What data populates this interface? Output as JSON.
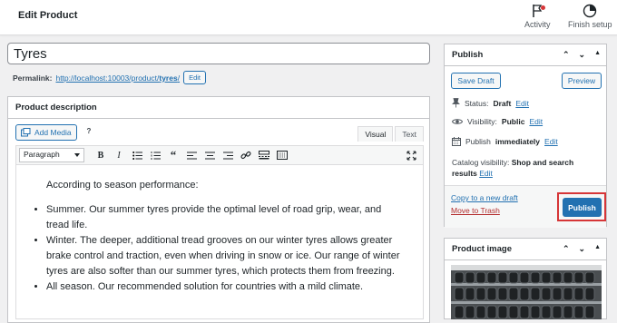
{
  "header": {
    "title": "Edit Product",
    "activity_label": "Activity",
    "finish_setup_label": "Finish setup"
  },
  "product": {
    "title_value": "Tyres",
    "permalink_label": "Permalink:",
    "permalink_base": "http://localhost:10003/product/",
    "permalink_slug": "tyres",
    "permalink_end": "/",
    "edit_label": "Edit"
  },
  "editor": {
    "panel_title": "Product description",
    "add_media_label": "Add Media",
    "help_label": "?",
    "tab_visual": "Visual",
    "tab_text": "Text",
    "format_value": "Paragraph",
    "intro": "According to season performance:",
    "bullets": [
      "Summer. Our summer tyres provide the optimal level of road grip, wear, and tread life.",
      "Winter. The deeper, additional tread grooves on our winter tyres allows greater brake control and traction, even when driving in snow or ice. Our range of winter tyres are also softer than our summer tyres, which protects them from freezing.",
      "All season. Our recommended solution for countries with a mild climate."
    ]
  },
  "publish": {
    "title": "Publish",
    "save_draft_label": "Save Draft",
    "preview_label": "Preview",
    "status_label": "Status:",
    "status_value": "Draft",
    "visibility_label": "Visibility:",
    "visibility_value": "Public",
    "publish_label": "Publish",
    "publish_value": "immediately",
    "edit_label": "Edit",
    "catalog_label": "Catalog visibility:",
    "catalog_value": "Shop and search results",
    "copy_draft_label": "Copy to a new draft",
    "trash_label": "Move to Trash",
    "publish_button_label": "Publish"
  },
  "product_image": {
    "title": "Product image"
  }
}
